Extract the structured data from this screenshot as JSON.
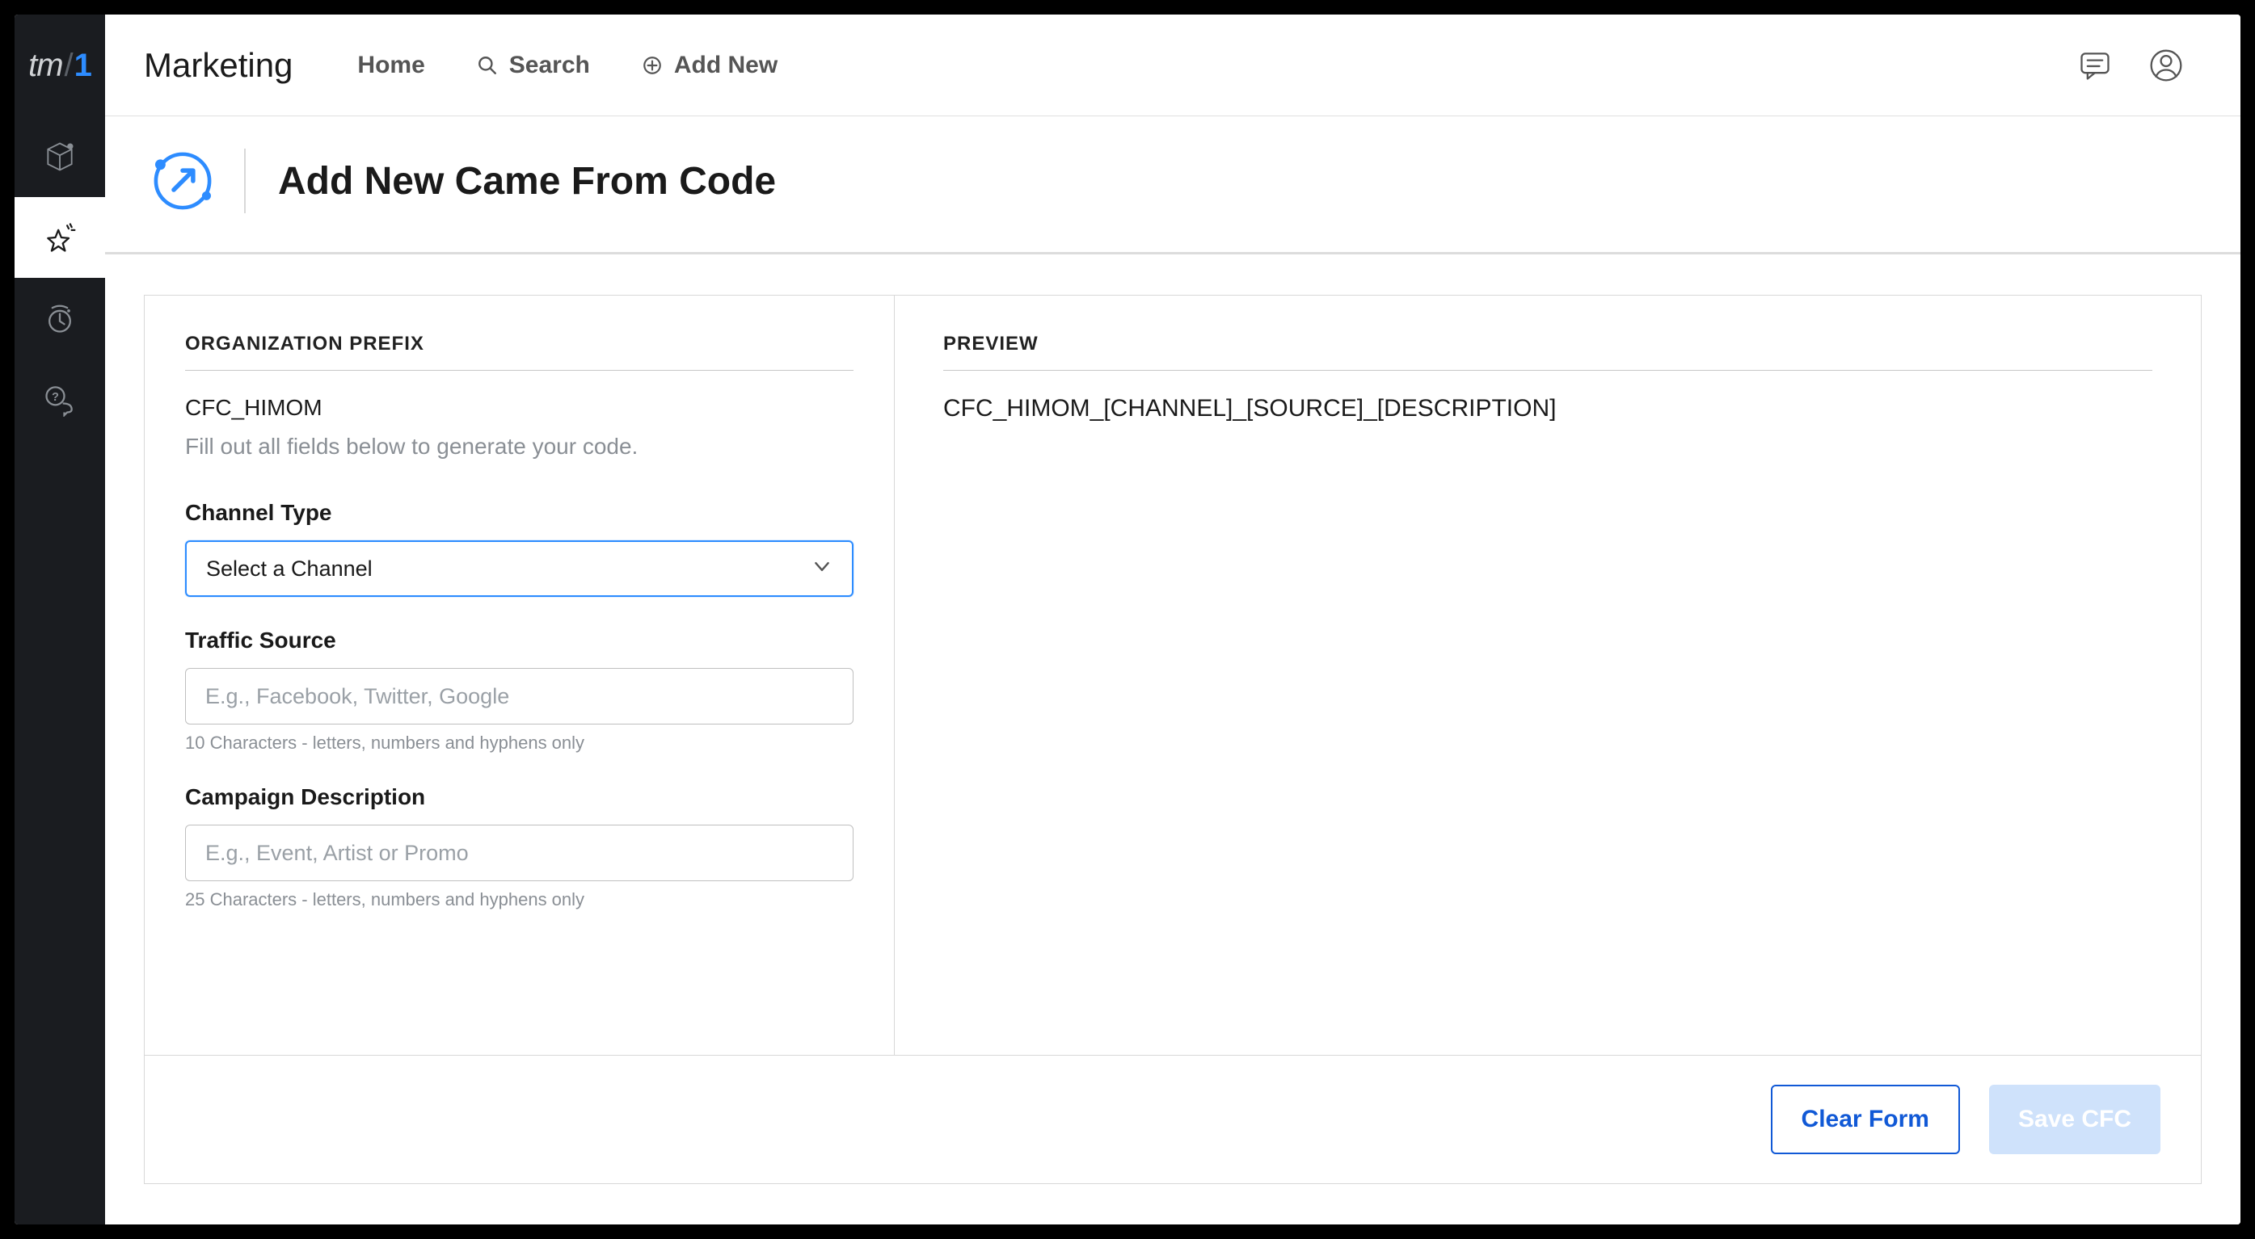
{
  "logo": {
    "tm": "tm",
    "slash": "/",
    "one": "1"
  },
  "module_name": "Marketing",
  "nav": {
    "home": "Home",
    "search": "Search",
    "add_new": "Add New"
  },
  "page": {
    "title": "Add New Came From Code"
  },
  "form": {
    "org_prefix_label": "ORGANIZATION PREFIX",
    "org_prefix_value": "CFC_HIMOM",
    "helper": "Fill out all fields below to generate your code.",
    "channel_type": {
      "label": "Channel Type",
      "selected": "Select a Channel"
    },
    "traffic_source": {
      "label": "Traffic Source",
      "placeholder": "E.g., Facebook, Twitter, Google",
      "help": "10 Characters - letters, numbers and hyphens only"
    },
    "campaign_desc": {
      "label": "Campaign Description",
      "placeholder": "E.g., Event, Artist or Promo",
      "help": "25 Characters - letters, numbers and hyphens only"
    }
  },
  "preview": {
    "label": "PREVIEW",
    "value": "CFC_HIMOM_[CHANNEL]_[SOURCE]_[DESCRIPTION]"
  },
  "buttons": {
    "clear": "Clear Form",
    "save": "Save CFC"
  }
}
